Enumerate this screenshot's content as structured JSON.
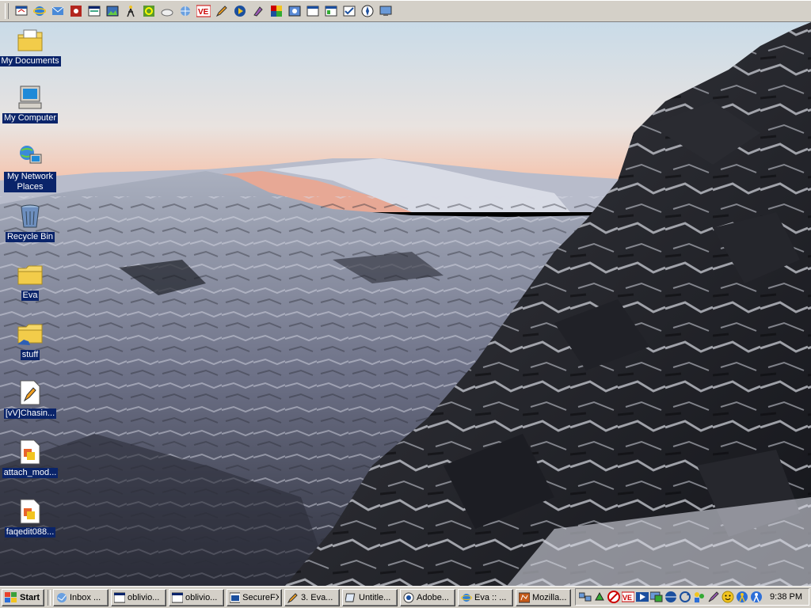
{
  "desktop": {
    "icons": [
      {
        "label": "My Documents"
      },
      {
        "label": "My Computer"
      },
      {
        "label": "My Network Places"
      },
      {
        "label": "Recycle Bin"
      },
      {
        "label": "Eva"
      },
      {
        "label": "stuff"
      },
      {
        "label": "[vV]Chasin..."
      },
      {
        "label": "attach_mod..."
      },
      {
        "label": "faqedit088..."
      }
    ]
  },
  "taskbar": {
    "start_label": "Start",
    "tasks": [
      {
        "label": "Inbox ..."
      },
      {
        "label": "oblivio..."
      },
      {
        "label": "oblivio..."
      },
      {
        "label": "SecureFX"
      },
      {
        "label": "3. Eva..."
      },
      {
        "label": "Untitle..."
      },
      {
        "label": "Adobe..."
      },
      {
        "label": "Eva :: ..."
      },
      {
        "label": "Mozilla..."
      }
    ],
    "clock": "9:38 PM"
  },
  "quick_launch": {
    "icons": [
      "show-desktop-icon",
      "internet-explorer-icon",
      "outlook-icon",
      "media-icon",
      "app-window-icon",
      "image-viewer-icon",
      "aim-icon",
      "refresh-app-icon",
      "cloud-icon",
      "network-icon",
      "ve-icon",
      "pencil-icon",
      "media-player-icon",
      "paint-icon",
      "palette-icon",
      "photo-icon",
      "window-app-icon",
      "window-app-2-icon",
      "checklist-icon",
      "compass-icon",
      "monitor-icon"
    ]
  },
  "colors": {
    "selection": "#0a246a",
    "chrome": "#d4d0c8"
  }
}
